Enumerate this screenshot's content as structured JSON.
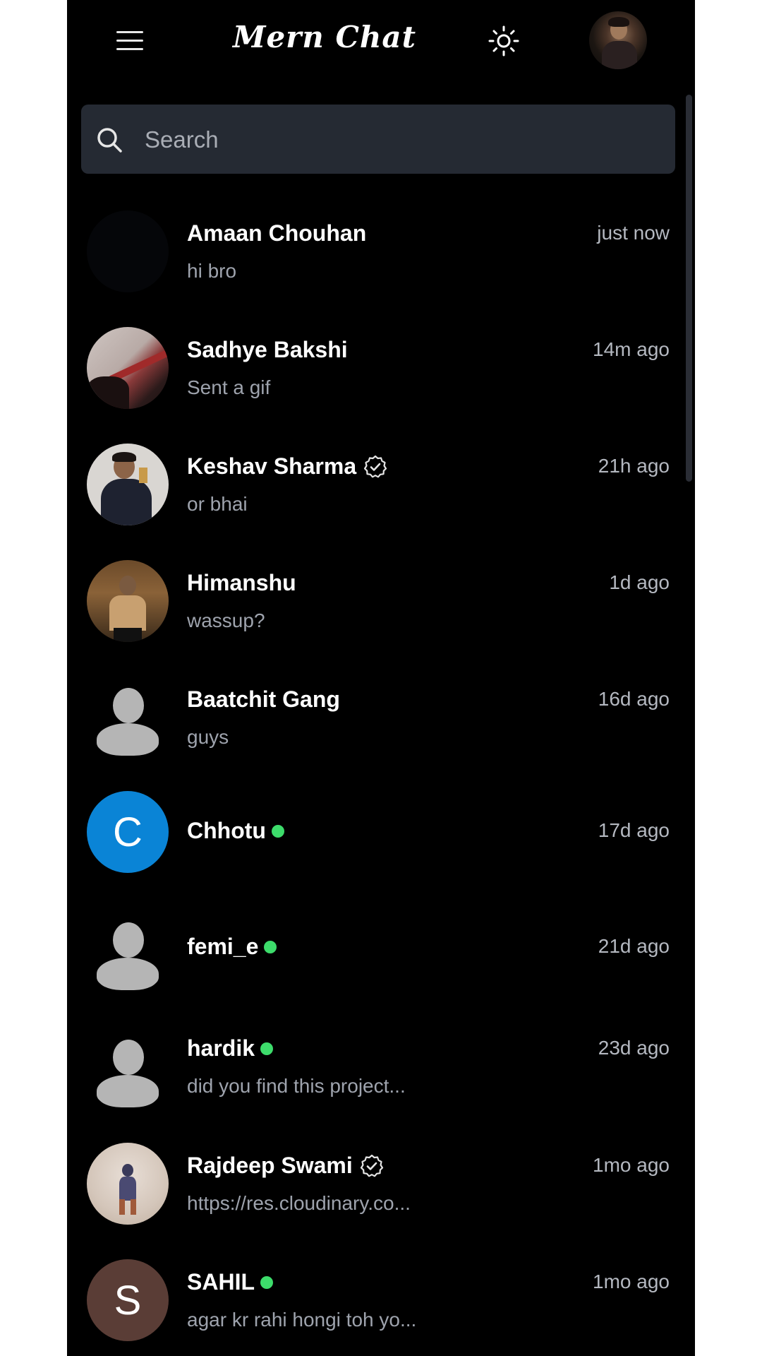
{
  "header": {
    "title": "Mern Chat",
    "menu_icon": "hamburger-menu-icon",
    "theme_icon": "sun-icon",
    "avatar_icon": "user-avatar"
  },
  "search": {
    "placeholder": "Search",
    "value": "",
    "icon": "search-icon"
  },
  "colors": {
    "background": "#000000",
    "search_bg": "#252a33",
    "online": "#3ddc6b",
    "chhotu_avatar": "#0a84d6",
    "sahil_avatar": "#5a3d36"
  },
  "chats": [
    {
      "name": "Amaan Chouhan",
      "message": "hi bro",
      "time": "just now",
      "verified": false,
      "online": false
    },
    {
      "name": "Sadhye Bakshi",
      "message": "Sent a gif",
      "time": "14m ago",
      "verified": false,
      "online": false
    },
    {
      "name": "Keshav Sharma",
      "message": "or bhai",
      "time": "21h ago",
      "verified": true,
      "online": false
    },
    {
      "name": "Himanshu",
      "message": "wassup?",
      "time": "1d ago",
      "verified": false,
      "online": false
    },
    {
      "name": "Baatchit Gang",
      "message": "guys",
      "time": "16d ago",
      "verified": false,
      "online": false
    },
    {
      "name": "Chhotu",
      "message": "",
      "time": "17d ago",
      "verified": false,
      "online": true,
      "avatar_letter": "C"
    },
    {
      "name": "femi_e",
      "message": "",
      "time": "21d ago",
      "verified": false,
      "online": true
    },
    {
      "name": "hardik",
      "message": "did you find this project...",
      "time": "23d ago",
      "verified": false,
      "online": true
    },
    {
      "name": "Rajdeep Swami",
      "message": "https://res.cloudinary.co...",
      "time": "1mo ago",
      "verified": true,
      "online": false
    },
    {
      "name": "SAHIL",
      "message": "agar kr rahi hongi toh yo...",
      "time": "1mo ago",
      "verified": false,
      "online": true,
      "avatar_letter": "S"
    }
  ]
}
